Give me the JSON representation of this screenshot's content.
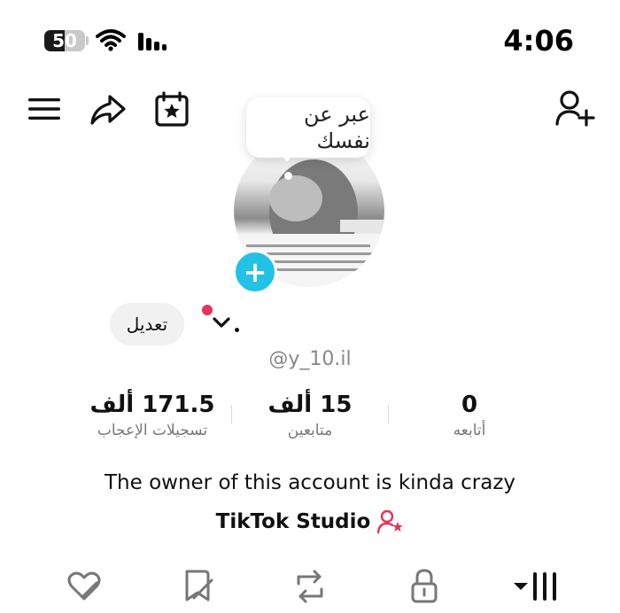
{
  "status_bar": {
    "battery_level": "50",
    "battery_fraction": 0.5,
    "time": "4:06",
    "icons": [
      "wifi-icon",
      "signal-icon"
    ]
  },
  "toolbar": {
    "icons": [
      "menu-icon",
      "share-icon",
      "calendar-star-icon",
      "add-friend-icon"
    ]
  },
  "profile": {
    "bio_prompt": "عبر عن نفسك",
    "edit_label": "تعديل",
    "handle": "@y_10.il",
    "bio": "The owner of this account is kinda crazy",
    "studio_label": "TikTok Studio",
    "accent": "#e8325a",
    "add_color": "#23c1e6"
  },
  "stats": [
    {
      "value": "171.5 ألف",
      "label": "تسجيلات الإعجاب"
    },
    {
      "value": "15 ألف",
      "label": "متابعين"
    },
    {
      "value": "0",
      "label": "أتابعه"
    }
  ],
  "bottom_tabs": {
    "icons": [
      "liked-icon",
      "favorites-icon",
      "repost-icon",
      "private-lock-icon",
      "videos-grid-icon"
    ]
  }
}
